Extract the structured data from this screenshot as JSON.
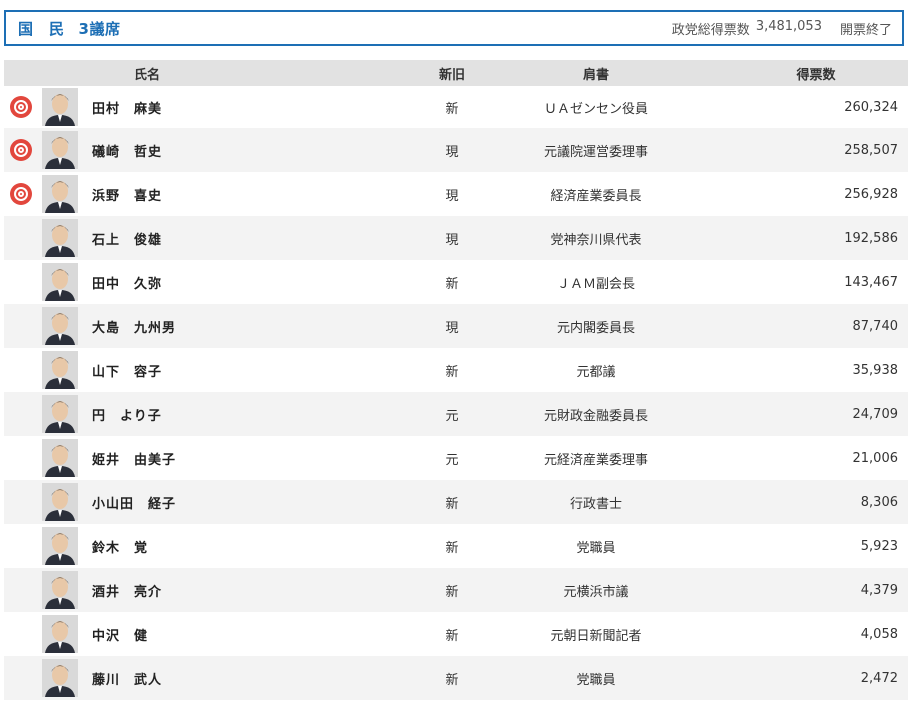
{
  "header": {
    "party_label": "国　民",
    "seats_label": "3議席",
    "total_votes_label": "政党総得票数",
    "total_votes": "3,481,053",
    "status": "開票終了"
  },
  "columns": {
    "name": "氏名",
    "shinkyu": "新旧",
    "title": "肩書",
    "votes": "得票数"
  },
  "rows": [
    {
      "elected": true,
      "name": "田村　麻美",
      "shinkyu": "新",
      "title": "ＵＡゼンセン役員",
      "votes": "260,324"
    },
    {
      "elected": true,
      "name": "礒崎　哲史",
      "shinkyu": "現",
      "title": "元議院運営委理事",
      "votes": "258,507"
    },
    {
      "elected": true,
      "name": "浜野　喜史",
      "shinkyu": "現",
      "title": "経済産業委員長",
      "votes": "256,928"
    },
    {
      "elected": false,
      "name": "石上　俊雄",
      "shinkyu": "現",
      "title": "党神奈川県代表",
      "votes": "192,586"
    },
    {
      "elected": false,
      "name": "田中　久弥",
      "shinkyu": "新",
      "title": "ＪＡＭ副会長",
      "votes": "143,467"
    },
    {
      "elected": false,
      "name": "大島　九州男",
      "shinkyu": "現",
      "title": "元内閣委員長",
      "votes": "87,740"
    },
    {
      "elected": false,
      "name": "山下　容子",
      "shinkyu": "新",
      "title": "元都議",
      "votes": "35,938"
    },
    {
      "elected": false,
      "name": "円　より子",
      "shinkyu": "元",
      "title": "元財政金融委員長",
      "votes": "24,709"
    },
    {
      "elected": false,
      "name": "姫井　由美子",
      "shinkyu": "元",
      "title": "元経済産業委理事",
      "votes": "21,006"
    },
    {
      "elected": false,
      "name": "小山田　経子",
      "shinkyu": "新",
      "title": "行政書士",
      "votes": "8,306"
    },
    {
      "elected": false,
      "name": "鈴木　覚",
      "shinkyu": "新",
      "title": "党職員",
      "votes": "5,923"
    },
    {
      "elected": false,
      "name": "酒井　亮介",
      "shinkyu": "新",
      "title": "元横浜市議",
      "votes": "4,379"
    },
    {
      "elected": false,
      "name": "中沢　健",
      "shinkyu": "新",
      "title": "元朝日新聞記者",
      "votes": "4,058"
    },
    {
      "elected": false,
      "name": "藤川　武人",
      "shinkyu": "新",
      "title": "党職員",
      "votes": "2,472"
    }
  ],
  "icons": {
    "elected": "elected-rose-icon",
    "photo": "candidate-photo"
  },
  "colors": {
    "accent": "#1d6fb5",
    "elected_mark": "#e2473d",
    "header_bg": "#e2e2e2",
    "alt_row_bg": "#f3f3f3"
  }
}
